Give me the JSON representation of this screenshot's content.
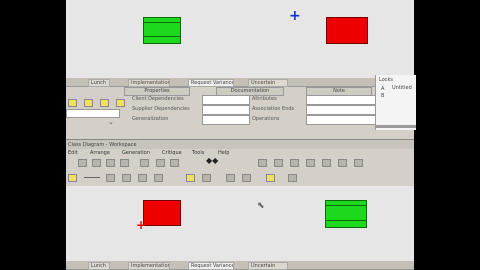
{
  "colors": {
    "accent_green": "#1ed81e",
    "accent_red": "#e00000",
    "canvas": "#e6e6e6",
    "chrome": "#d4d0c8"
  },
  "top_tabs": [
    "Lunch",
    "Implementation",
    "Request Variance",
    "Uncertain"
  ],
  "properties": {
    "tabs": [
      "Properties",
      "Documentation",
      "Note"
    ],
    "rows_left": [
      "Client Dependencies",
      "Supplier Dependencies",
      "Generalization"
    ],
    "rows_right": [
      "Attributes",
      "Association Ends",
      "Operations"
    ]
  },
  "side_panel": {
    "items": [
      "Locks",
      "Untitled",
      "A",
      "B"
    ]
  },
  "bottom_title": "Class Diagram - Workspace",
  "menu": [
    "Edit",
    "Arrange",
    "Generation",
    "Critique",
    "Tools",
    "Help"
  ],
  "bottom_tabs": [
    "Lunch",
    "Implementation",
    "Request Variance",
    "Uncertain"
  ]
}
